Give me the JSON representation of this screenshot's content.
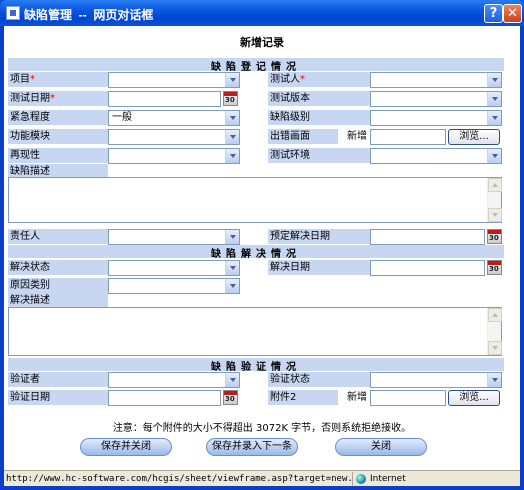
{
  "window": {
    "title": "缺陷管理  --  网页对话框",
    "help_label": "?",
    "close_label": "✕"
  },
  "form": {
    "title": "新增记录",
    "sections": {
      "register": "缺陷登记情况",
      "resolve": "缺陷解决情况",
      "verify": "缺陷验证情况"
    },
    "fields": {
      "project": "项目",
      "tester": "测试人",
      "test_date": "测试日期",
      "test_version": "测试版本",
      "urgency": "紧急程度",
      "urgency_value": "一般",
      "severity": "缺陷级别",
      "module": "功能模块",
      "error_screen": "出错画面",
      "add_label_1": "新增",
      "reproducible": "再现性",
      "test_env": "测试环境",
      "description": "缺陷描述",
      "owner": "责任人",
      "planned_date": "预定解决日期",
      "resolve_status": "解决状态",
      "resolve_date": "解决日期",
      "cause_type": "原因类别",
      "resolve_desc": "解决描述",
      "verifier": "验证者",
      "verify_status": "验证状态",
      "verify_date": "验证日期",
      "attachment2": "附件2",
      "add_label_2": "新增",
      "required_mark": "*",
      "browse": "浏览..."
    },
    "note": "注意：每个附件的大小不得超出 3072K 字节，否则系统拒绝接收。",
    "buttons": {
      "save_close": "保存并关闭",
      "save_next": "保存并录入下一条",
      "close": "关闭"
    }
  },
  "status": {
    "url": "http://www.hc-software.com/hcgis/sheet/viewframe.asp?target=new.asp?Sheet...",
    "zone": "Internet"
  }
}
